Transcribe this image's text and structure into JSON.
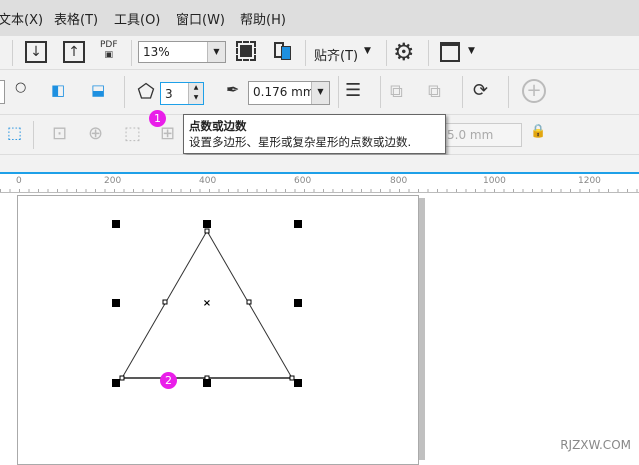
{
  "menu": [
    "文本(X)",
    "表格(T)",
    "工具(O)",
    "窗口(W)",
    "帮助(H)"
  ],
  "toolbar1": {
    "pdf_label": "PDF",
    "zoom_value": "13%",
    "snap_label": "贴齐(T)"
  },
  "toolbar2": {
    "points_value": "3",
    "outline_width": "0.176 mm"
  },
  "toolbar3": {
    "size_value": "5.0 mm"
  },
  "tooltip": {
    "title": "点数或边数",
    "body": "设置多边形、星形或复杂星形的点数或边数."
  },
  "badges": [
    "1",
    "2"
  ],
  "ruler_ticks": [
    "0",
    "200",
    "400",
    "600",
    "800",
    "1000",
    "1200"
  ],
  "watermark": "RJZXW.COM",
  "colors": {
    "accent": "#1ea0e8",
    "highlight": "#e53935",
    "badge": "#e91ee9"
  }
}
